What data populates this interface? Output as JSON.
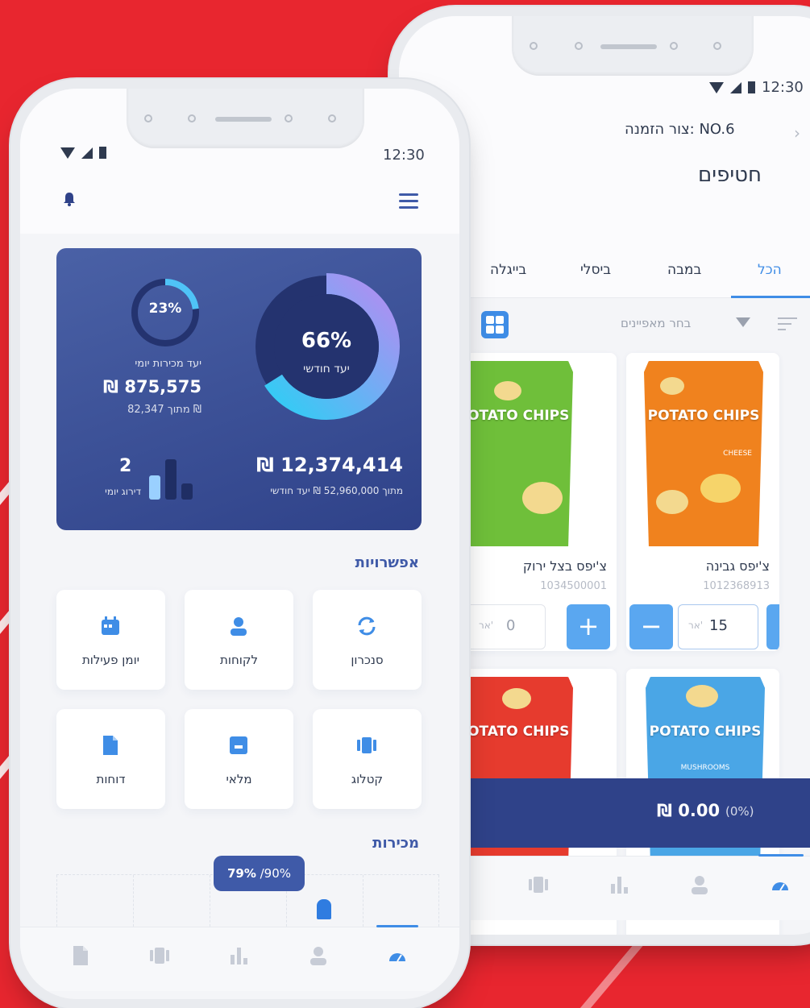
{
  "colors": {
    "background": "#e8262f",
    "primary": "#3f5aa8",
    "accent": "#3f8de6",
    "card": "#2f4289"
  },
  "front": {
    "time": "12:30",
    "icons": {
      "bell": "bell-icon",
      "menu": "menu-icon"
    },
    "dashboard": {
      "monthly_percent": "66%",
      "monthly_label": "יעד חודשי",
      "monthly_percent_value": 66,
      "daily_percent": "23%",
      "daily_percent_value": 23,
      "daily_title": "יעד מכירות יומי",
      "daily_amount": "₪ 875,575",
      "daily_of": "מתוך 82,347 ₪",
      "monthly_amount": "₪ 12,374,414",
      "monthly_of": "מתוך 52,960,000 ₪ יעד חודשי",
      "rank_value": "2",
      "rank_label": "דירוג יומי"
    },
    "options_title": "אפשרויות",
    "tiles": [
      {
        "label": "סנכרון",
        "icon": "sync-icon"
      },
      {
        "label": "לקוחות",
        "icon": "user-icon"
      },
      {
        "label": "יומן פעילות",
        "icon": "calendar-icon"
      },
      {
        "label": "קטלוג",
        "icon": "catalog-icon"
      },
      {
        "label": "מלאי",
        "icon": "inventory-icon"
      },
      {
        "label": "דוחות",
        "icon": "document-icon"
      }
    ],
    "sales_title": "מכירות",
    "sales_tip_value": "79%",
    "sales_tip_target": " /90%",
    "nav": [
      "dashboard-icon",
      "user-icon",
      "chart-icon",
      "catalog-icon",
      "document-icon"
    ]
  },
  "back": {
    "time": "12:30",
    "order_id": "צור הזמנה: NO.6",
    "category_title": "חטיפים",
    "tabs": [
      "הכל",
      "במבה",
      "ביסלי",
      "בייגלה"
    ],
    "filter_placeholder": "בחר מאפיינים",
    "products": [
      {
        "name": "צ'יפס גבינה",
        "code": "1012368913",
        "brand": "POTATO CHIPS",
        "flavor": "CHEESE",
        "unit": "אר'",
        "qty": "15",
        "color": "#f0821e"
      },
      {
        "name": "צ'יפס בצל ירוק",
        "code": "1034500001",
        "brand": "POTATO CHIPS",
        "flavor": "",
        "unit": "אר'",
        "qty": "0",
        "color": "#6fbf3a"
      },
      {
        "name": "",
        "code": "",
        "brand": "POTATO CHIPS",
        "flavor": "MUSHROOMS",
        "unit": "",
        "qty": "",
        "color": "#4aa6e6"
      },
      {
        "name": "",
        "code": "",
        "brand": "POTATO CHIPS",
        "flavor": "",
        "unit": "",
        "qty": "",
        "color": "#e63b2e"
      }
    ],
    "cart_total": "₪ 0.00",
    "cart_percent": "(0%)",
    "nav": [
      "dashboard-icon",
      "user-icon",
      "chart-icon",
      "catalog-icon"
    ]
  }
}
